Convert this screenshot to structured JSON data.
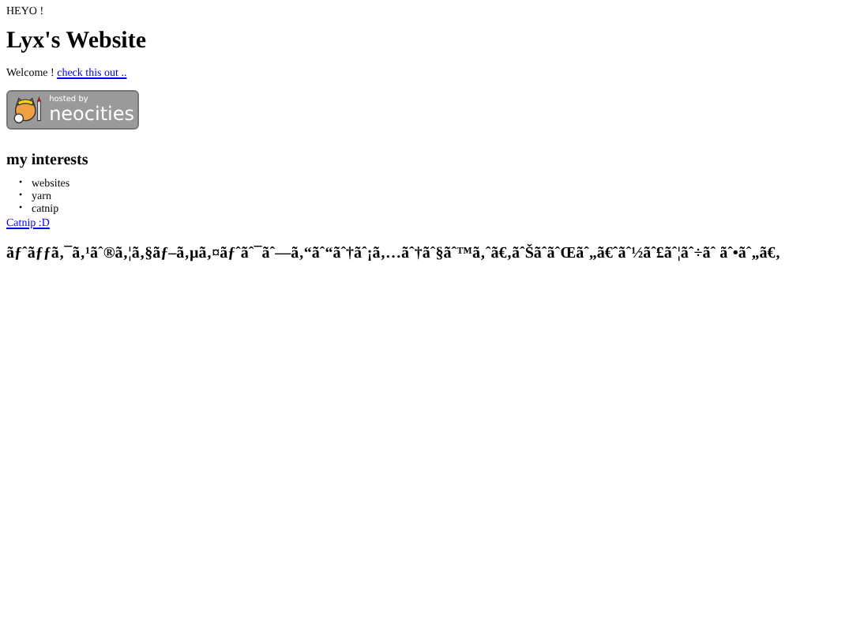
{
  "greeting": "HEYO !",
  "title": "Lyx's Website",
  "welcome": {
    "text": "Welcome !",
    "link": "check this out .."
  },
  "badge": {
    "small": "hosted by",
    "big": "neocities"
  },
  "interests": {
    "heading": "my interests",
    "marker": "•",
    "items": [
      "websites",
      "yarn",
      "catnip"
    ]
  },
  "catnip_link": "Catnip :D",
  "garbled": "ãƒˆãƒƒã‚¯ã‚¹ãˆ®ã‚¦ã‚§ãƒ–ã‚µã‚¤ãƒˆãˆ¯ãˆ—ã‚“ãˆ“ãˆ†ãˆ¡ã‚…ãˆ†ãˆ§ãˆ™ã‚ˆã€‚ãˆŠãˆãˆŒãˆ„ã€ˆãˆ½ãˆ£ãˆ¦ãˆ÷ãˆ ãˆ•ãˆ„ã€‚"
}
